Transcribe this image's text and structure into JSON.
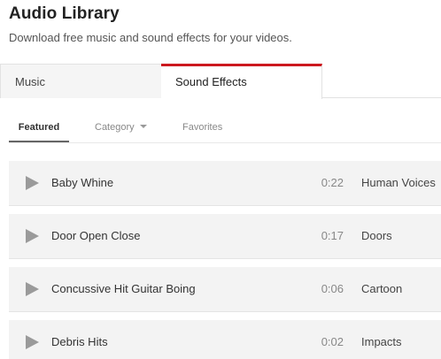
{
  "header": {
    "title": "Audio Library",
    "subtitle": "Download free music and sound effects for your videos."
  },
  "main_tabs": [
    {
      "label": "Music",
      "active": false
    },
    {
      "label": "Sound Effects",
      "active": true
    }
  ],
  "sub_tabs": {
    "featured": "Featured",
    "category": "Category",
    "favorites": "Favorites"
  },
  "colors": {
    "active_tab_accent": "#cc181e",
    "row_background": "#f3f3f3",
    "play_icon": "#9a9a9a"
  },
  "tracks": [
    {
      "name": "Baby Whine",
      "duration": "0:22",
      "genre": "Human Voices"
    },
    {
      "name": "Door Open Close",
      "duration": "0:17",
      "genre": "Doors"
    },
    {
      "name": "Concussive Hit Guitar Boing",
      "duration": "0:06",
      "genre": "Cartoon"
    },
    {
      "name": "Debris Hits",
      "duration": "0:02",
      "genre": "Impacts"
    }
  ]
}
